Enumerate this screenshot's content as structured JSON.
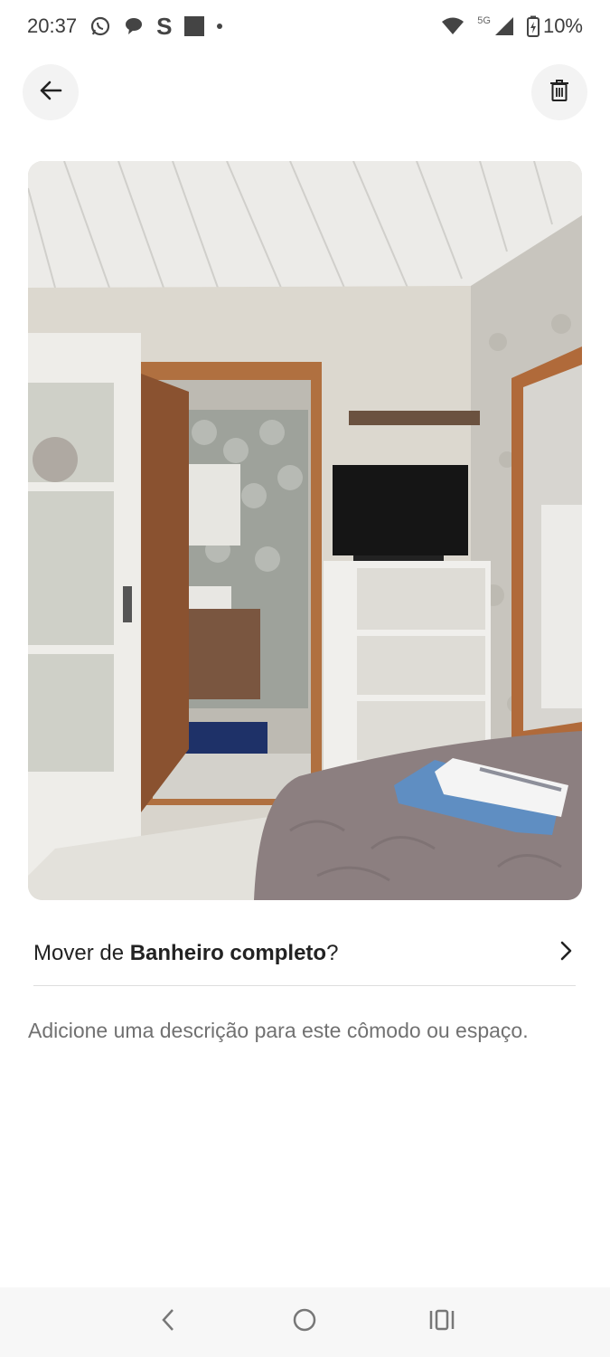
{
  "status_bar": {
    "time": "20:37",
    "left_icons": [
      "whatsapp-icon",
      "chat-bubble-icon",
      "s-app-icon",
      "square-notification-icon",
      "dot-icon"
    ],
    "network": "5G",
    "battery": "10%"
  },
  "header": {
    "back_icon": "arrow-left-icon",
    "delete_icon": "trash-icon"
  },
  "photo": {
    "description_icon": "room-photo"
  },
  "move": {
    "prefix": "Mover de ",
    "room": "Banheiro completo",
    "suffix": "?",
    "chevron_icon": "chevron-right-icon"
  },
  "description": {
    "placeholder": "Adicione uma descrição para este cômodo ou espaço."
  },
  "nav": {
    "back_icon": "nav-back-icon",
    "home_icon": "nav-home-icon",
    "recents_icon": "nav-recents-icon"
  }
}
